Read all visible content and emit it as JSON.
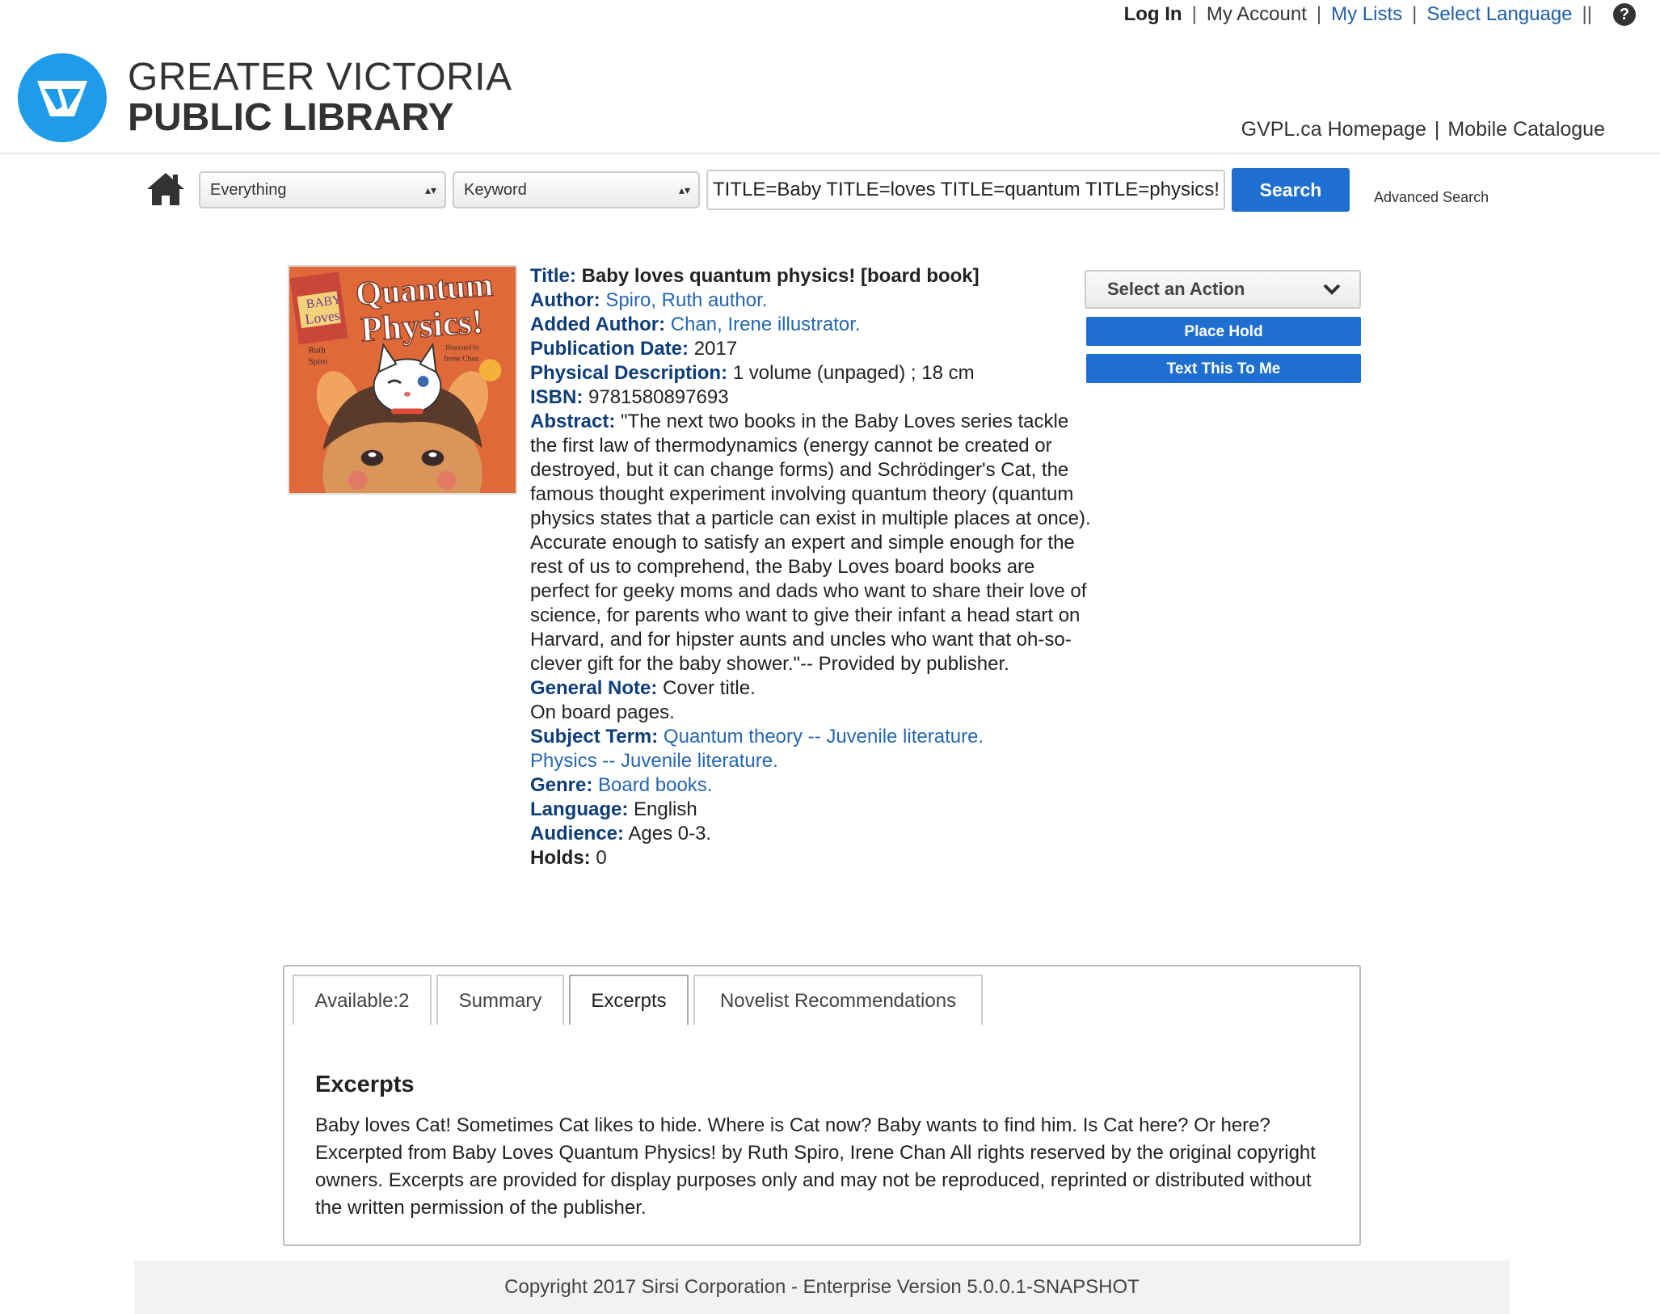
{
  "topbar": {
    "login": "Log In",
    "my_account": "My Account",
    "my_lists": "My Lists",
    "select_language": "Select Language",
    "sep": "|",
    "sep_double": "||",
    "help": "?"
  },
  "logo": {
    "line1": "GREATER VICTORIA",
    "line2": "PUBLIC LIBRARY"
  },
  "sitelinks": {
    "homepage": "GVPL.ca Homepage",
    "mobile": "Mobile Catalogue",
    "sep": "|"
  },
  "search": {
    "scope": "Everything",
    "type": "Keyword",
    "query": "TITLE=Baby TITLE=loves TITLE=quantum TITLE=physics! A",
    "button": "Search",
    "advanced": "Advanced Search"
  },
  "cover": {
    "small_top": "BABY",
    "small_bottom": "Loves",
    "line1": "Quantum",
    "line2": "Physics!",
    "author1": "Ruth",
    "author2": "Spiro",
    "illus1": "Illustrated by",
    "illus2": "Irene Chan"
  },
  "record": {
    "title_label": "Title:",
    "title": "Baby loves quantum physics! [board book]",
    "author_label": "Author:",
    "author": "Spiro, Ruth author.",
    "added_author_label": "Added Author:",
    "added_author": "Chan, Irene illustrator.",
    "pubdate_label": "Publication Date:",
    "pubdate": "2017",
    "physdesc_label": "Physical Description:",
    "physdesc": "1 volume (unpaged) ; 18 cm",
    "isbn_label": "ISBN:",
    "isbn": "9781580897693",
    "abstract_label": "Abstract:",
    "abstract": "\"The next two books in the Baby Loves series tackle the first law of thermodynamics (energy cannot be created or destroyed, but it can change forms) and Schrödinger's Cat, the famous thought experiment involving quantum theory (quantum physics states that a particle can exist in multiple places at once). Accurate enough to satisfy an expert and simple enough for the rest of us to comprehend, the Baby Loves board books are perfect for geeky moms and dads who want to share their love of science, for parents who want to give their infant a head start on Harvard, and for hipster aunts and uncles who want that oh-so-clever gift for the baby shower.\"-- Provided by publisher.",
    "general_note_label": "General Note:",
    "general_note_1": "Cover title.",
    "general_note_2": "On board pages.",
    "subject_label": "Subject Term:",
    "subject_1": "Quantum theory -- Juvenile literature.",
    "subject_2": "Physics -- Juvenile literature.",
    "genre_label": "Genre:",
    "genre": "Board books.",
    "language_label": "Language:",
    "language": "English",
    "audience_label": "Audience:",
    "audience": "Ages 0-3.",
    "holds_label": "Holds:",
    "holds": "0"
  },
  "actions": {
    "select": "Select an Action",
    "place_hold": "Place Hold",
    "text_this": "Text This To Me"
  },
  "tabs": {
    "available": "Available:2",
    "summary": "Summary",
    "excerpts": "Excerpts",
    "novelist": "Novelist Recommendations",
    "active": "Excerpts"
  },
  "excerpts": {
    "heading": "Excerpts",
    "text": "Baby loves Cat! Sometimes Cat likes to hide. Where is Cat now? Baby wants to find him.  Is Cat here? Or here? Excerpted from Baby Loves Quantum Physics! by Ruth Spiro, Irene Chan All rights reserved by the original copyright owners. Excerpts are provided for display purposes only and may not be reproduced, reprinted or distributed without the written permission of the publisher."
  },
  "footer": {
    "text": "Copyright 2017 Sirsi Corporation - Enterprise Version 5.0.0.1-SNAPSHOT"
  },
  "colors": {
    "brand_blue": "#1e9be9",
    "button_blue": "#1e6fd0",
    "label_navy": "#0d3d7a",
    "link_blue": "#2467b3",
    "cover_orange": "#e0693a"
  }
}
